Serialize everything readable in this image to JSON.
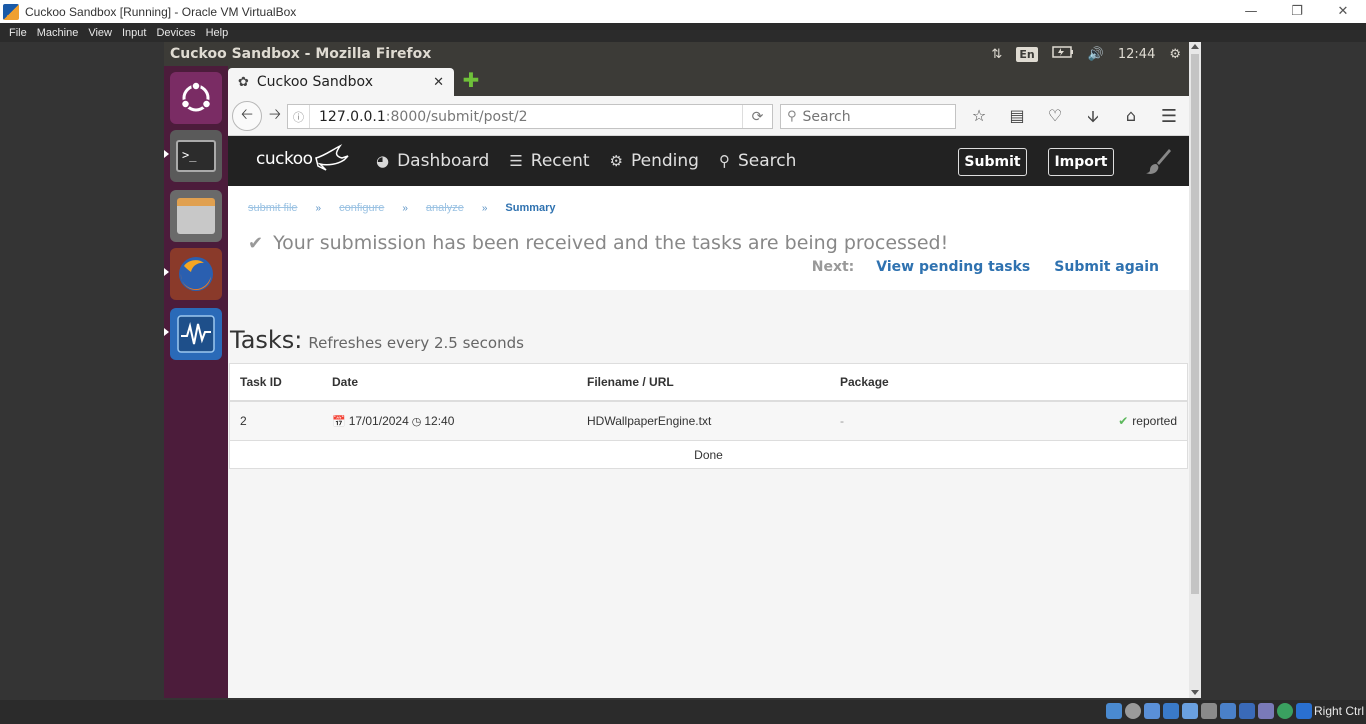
{
  "host": {
    "title": "Cuckoo Sandbox [Running] - Oracle VM VirtualBox",
    "menu": [
      "File",
      "Machine",
      "View",
      "Input",
      "Devices",
      "Help"
    ],
    "host_key": "Right Ctrl"
  },
  "guest": {
    "window_title": "Cuckoo Sandbox - Mozilla Firefox",
    "lang": "En",
    "clock": "12:44"
  },
  "firefox": {
    "tab_title": "Cuckoo Sandbox",
    "url_host": "127.0.0.1",
    "url_path": ":8000/submit/post/2",
    "search_placeholder": "Search"
  },
  "cuckoo": {
    "logo": "cuckoo",
    "nav": [
      "Dashboard",
      "Recent",
      "Pending",
      "Search"
    ],
    "submit_label": "Submit",
    "import_label": "Import",
    "breadcrumb": [
      "submit file",
      "configure",
      "analyze",
      "Summary"
    ],
    "success_message": "Your submission has been received and the tasks are being processed!",
    "next_label": "Next:",
    "next_links": [
      "View pending tasks",
      "Submit again"
    ],
    "tasks_title": "Tasks:",
    "tasks_subtitle": "Refreshes every 2.5 seconds",
    "table": {
      "columns": [
        "Task ID",
        "Date",
        "Filename / URL",
        "Package"
      ],
      "rows": [
        {
          "id": "2",
          "date": "17/01/2024",
          "time": "12:40",
          "filename": "HDWallpaperEngine.txt",
          "package": "-",
          "status": "reported"
        }
      ],
      "footer": "Done"
    }
  }
}
